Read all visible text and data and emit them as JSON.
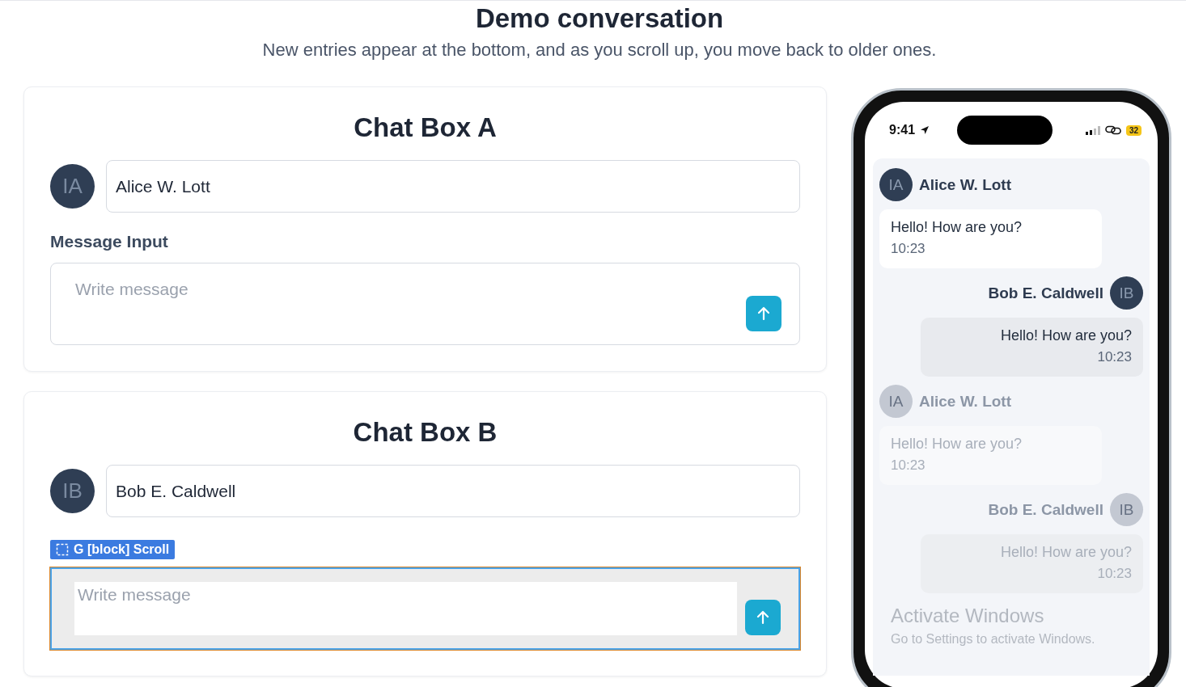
{
  "header": {
    "title": "Demo conversation",
    "subtitle": "New entries appear at the bottom, and as you scroll up, you move back to older ones."
  },
  "chat_boxes": [
    {
      "title": "Chat Box A",
      "avatar_initials": "IA",
      "name_value": "Alice W. Lott",
      "input_label": "Message Input",
      "message_placeholder": "Write message",
      "highlighted": false
    },
    {
      "title": "Chat Box B",
      "avatar_initials": "IB",
      "name_value": "Bob E. Caldwell",
      "message_placeholder": "Write message",
      "highlighted": true,
      "debug_badge": "G [block] Scroll"
    }
  ],
  "phone": {
    "time": "9:41",
    "battery": "32",
    "messages": [
      {
        "sender": "Alice W. Lott",
        "initials": "IA",
        "kind": "incoming",
        "text": "Hello! How are you?",
        "time": "10:23",
        "faded": false
      },
      {
        "sender": "Bob E. Caldwell",
        "initials": "IB",
        "kind": "outgoing",
        "text": "Hello! How are you?",
        "time": "10:23",
        "faded": false
      },
      {
        "sender": "Alice W. Lott",
        "initials": "IA",
        "kind": "incoming",
        "text": "Hello! How are you?",
        "time": "10:23",
        "faded": true
      },
      {
        "sender": "Bob E. Caldwell",
        "initials": "IB",
        "kind": "outgoing",
        "text": "Hello! How are you?",
        "time": "10:23",
        "faded": true
      }
    ]
  },
  "os_notice": {
    "title": "Activate Windows",
    "text": "Go to Settings to activate Windows."
  }
}
